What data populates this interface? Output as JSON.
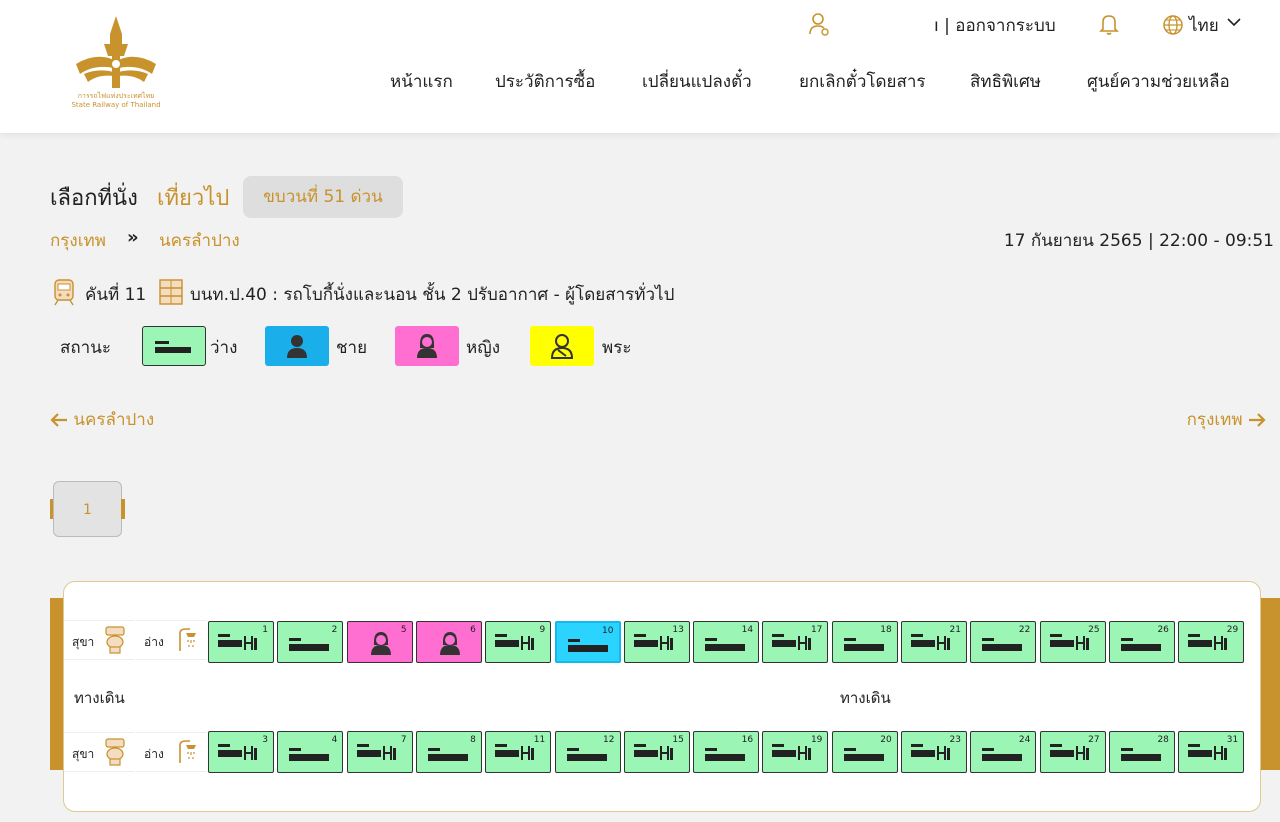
{
  "header": {
    "logo_caption_th": "การรถไฟแห่งประเทศไทย",
    "logo_caption_en": "State Railway of Thailand",
    "logout_label": "ı | ออกจากระบบ",
    "language": "ไทย",
    "nav": [
      "หน้าแรก",
      "ประวัติการซื้อ",
      "เปลี่ยนแปลงตั๋ว",
      "ยกเลิกตั๋วโดยสาร",
      "สิทธิพิเศษ",
      "ศูนย์ความช่วยเหลือ"
    ]
  },
  "title": {
    "main": "เลือกที่นั่ง",
    "trip": "เที่ยวไป",
    "train_badge": "ขบวนที่  51  ด่วน"
  },
  "route": {
    "from": "กรุงเทพ",
    "arrow": "»",
    "to": "นครลำปาง",
    "datetime": "17 กันยายน 2565 | 22:00 - 09:51"
  },
  "car": {
    "number": "คันที่ 11",
    "description": "บนท.ป.40 : รถโบกี้นั่งและนอน ชั้น 2 ปรับอากาศ - ผู้โดยสารทั่วไป"
  },
  "legend": {
    "title": "สถานะ",
    "items": [
      {
        "label": "ว่าง",
        "color": "#9bf5b4"
      },
      {
        "label": "ชาย",
        "color": "#1aaeea"
      },
      {
        "label": "หญิง",
        "color": "#ff6fd1"
      },
      {
        "label": "พระ",
        "color": "#ffff00"
      }
    ]
  },
  "direction": {
    "left": "นครลำปาง",
    "right": "กรุงเทพ"
  },
  "pagination": {
    "current": "1"
  },
  "coach_map": {
    "toilet_label": "สุขา",
    "sink_label": "อ่าง",
    "aisle_label": "ทางเดิน",
    "top_row": [
      {
        "num": "1",
        "type": "lower",
        "status": "available"
      },
      {
        "num": "2",
        "type": "upper",
        "status": "available"
      },
      {
        "num": "5",
        "type": "lower",
        "status": "female"
      },
      {
        "num": "6",
        "type": "upper",
        "status": "female"
      },
      {
        "num": "9",
        "type": "lower",
        "status": "available"
      },
      {
        "num": "10",
        "type": "upper",
        "status": "selected"
      },
      {
        "num": "13",
        "type": "lower",
        "status": "available"
      },
      {
        "num": "14",
        "type": "upper",
        "status": "available"
      },
      {
        "num": "17",
        "type": "lower",
        "status": "available"
      },
      {
        "num": "18",
        "type": "upper",
        "status": "available"
      },
      {
        "num": "21",
        "type": "lower",
        "status": "available"
      },
      {
        "num": "22",
        "type": "upper",
        "status": "available"
      },
      {
        "num": "25",
        "type": "lower",
        "status": "available"
      },
      {
        "num": "26",
        "type": "upper",
        "status": "available"
      },
      {
        "num": "29",
        "type": "lower",
        "status": "available"
      }
    ],
    "bottom_row": [
      {
        "num": "3",
        "type": "lower",
        "status": "available"
      },
      {
        "num": "4",
        "type": "upper",
        "status": "available"
      },
      {
        "num": "7",
        "type": "lower",
        "status": "available"
      },
      {
        "num": "8",
        "type": "upper",
        "status": "available"
      },
      {
        "num": "11",
        "type": "lower",
        "status": "available"
      },
      {
        "num": "12",
        "type": "upper",
        "status": "available"
      },
      {
        "num": "15",
        "type": "lower",
        "status": "available"
      },
      {
        "num": "16",
        "type": "upper",
        "status": "available"
      },
      {
        "num": "19",
        "type": "lower",
        "status": "available"
      },
      {
        "num": "20",
        "type": "upper",
        "status": "available"
      },
      {
        "num": "23",
        "type": "lower",
        "status": "available"
      },
      {
        "num": "24",
        "type": "upper",
        "status": "available"
      },
      {
        "num": "27",
        "type": "lower",
        "status": "available"
      },
      {
        "num": "28",
        "type": "upper",
        "status": "available"
      },
      {
        "num": "31",
        "type": "lower",
        "status": "available"
      }
    ]
  },
  "colors": {
    "accent": "#c8922c",
    "available": "#9bf5b4",
    "female": "#ff6fd1",
    "selected": "#2ad4ff"
  }
}
